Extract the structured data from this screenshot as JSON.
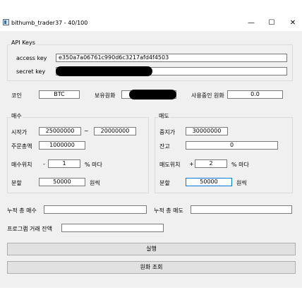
{
  "window": {
    "title": "bithumb_trader37 - 40/100",
    "minimize": "—",
    "maximize": "☐",
    "close": "✕"
  },
  "api": {
    "group_label": "API Keys",
    "access_label": "access key",
    "access_value": "e350a7a06761c990d6c3217afd4f4503",
    "secret_label": "secret key",
    "secret_value": ""
  },
  "top": {
    "coin_label": "코인",
    "coin_value": "BTC",
    "holding_label": "보유원화",
    "holding_value": "",
    "inuse_label": "사용중인 원화",
    "inuse_value": "0.0"
  },
  "buy": {
    "group_label": "매수",
    "start_label": "시작가",
    "start_value": "25000000",
    "tilde": "~",
    "end_value": "20000000",
    "order_total_label": "주문총액",
    "order_total_value": "1000000",
    "position_label": "매수위치",
    "position_sign": "-",
    "position_value": "1",
    "position_suffix": "% 마다",
    "split_label": "분할",
    "split_value": "50000",
    "split_unit": "원씩"
  },
  "sell": {
    "group_label": "매도",
    "stop_label": "중지가",
    "stop_value": "30000000",
    "balance_label": "잔고",
    "balance_value": "0",
    "position_label": "매도위치",
    "position_sign": "+",
    "position_value": "2",
    "position_suffix": "% 마다",
    "split_label": "분할",
    "split_value": "50000",
    "split_unit": "원씩"
  },
  "totals": {
    "total_buy_label": "누적 총 매수",
    "total_buy_value": "",
    "total_sell_label": "누적 총 매도",
    "total_sell_value": "",
    "program_balance_label": "프로그램 거래 잔액",
    "program_balance_value": ""
  },
  "buttons": {
    "run": "실행",
    "query": "원화 조회"
  }
}
